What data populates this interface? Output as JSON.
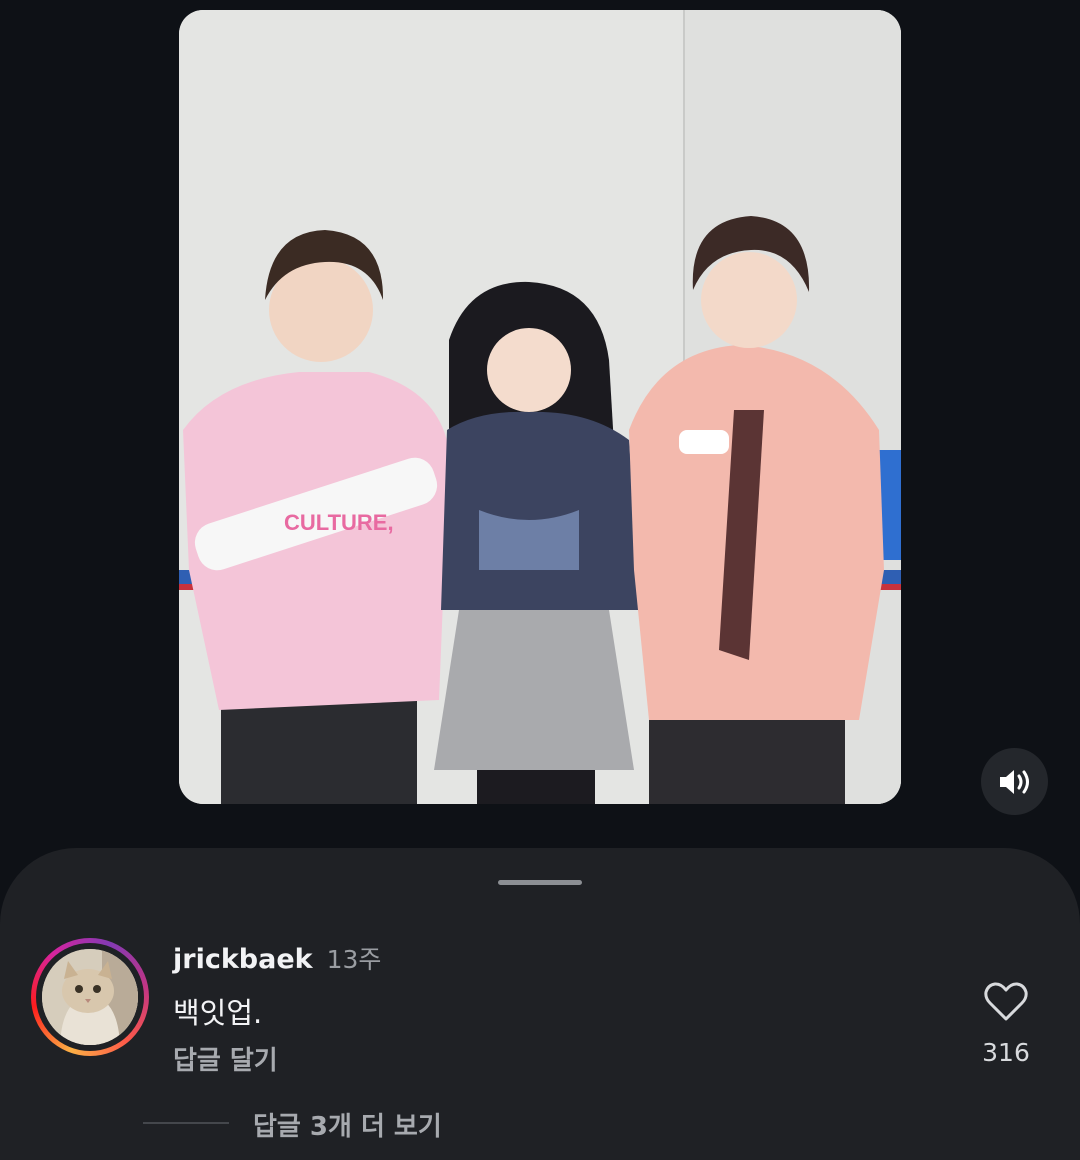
{
  "comment": {
    "username": "jrickbaek",
    "timestamp": "13주",
    "text": "백잇업.",
    "reply_label": "답글 달기",
    "like_count": "316",
    "view_replies_label": "답글 3개 더 보기",
    "avatar_icon": "cat-avatar"
  },
  "media": {
    "type": "video",
    "sound_icon": "speaker-on-icon"
  },
  "colors": {
    "background": "#0e1116",
    "sheet": "#1f2125",
    "text_primary": "#f2f3f5",
    "text_secondary": "#9a9da2"
  }
}
